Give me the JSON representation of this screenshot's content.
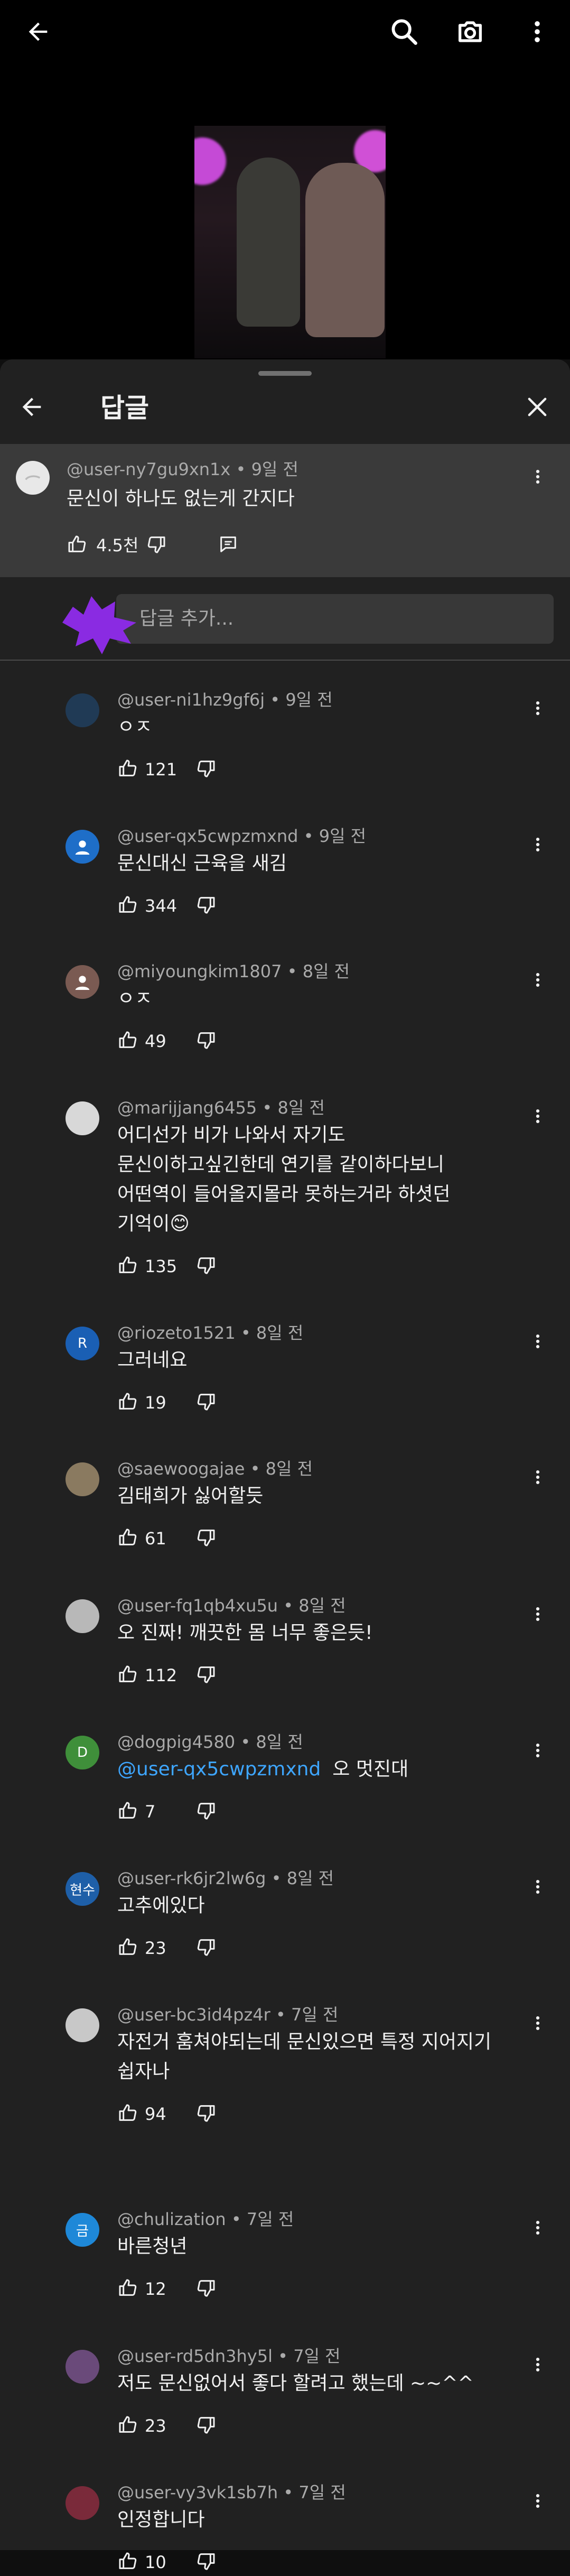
{
  "video": {
    "icons": [
      "back-arrow-icon",
      "search-icon",
      "camera-icon",
      "more-vert-icon"
    ]
  },
  "panel": {
    "title": "답글",
    "back_icon": "back-arrow-icon",
    "close_icon": "close-icon"
  },
  "parent_comment": {
    "author": "@user-ny7gu9xn1x",
    "time": "9일 전",
    "text": "문신이 하나도 없는게 간지다",
    "likes": "4.5천"
  },
  "add_reply": {
    "placeholder": "답글 추가..."
  },
  "replies": [
    {
      "author": "@user-ni1hz9gf6j",
      "time": "9일 전",
      "text": "ㅇㅈ",
      "likes": "121",
      "avatar": "img",
      "avatar_color": "#203a55"
    },
    {
      "author": "@user-qx5cwpzmxnd",
      "time": "9일 전",
      "text": "문신대신 근육을 새김",
      "likes": "344",
      "avatar": "person",
      "avatar_color": "#1e6ec8"
    },
    {
      "author": "@miyoungkim1807",
      "time": "8일 전",
      "text": "ㅇㅈ",
      "likes": "49",
      "avatar": "person",
      "avatar_color": "#7a5a52"
    },
    {
      "author": "@marijjang6455",
      "time": "8일 전",
      "text": "어디선가 비가 나와서 자기도\n문신이하고싶긴한데 연기를 같이하다보니\n어떤역이 들어올지몰라 못하는거라 하셧던\n기억이😊",
      "likes": "135",
      "avatar": "img",
      "avatar_color": "#d8d8d8"
    },
    {
      "author": "@riozeto1521",
      "time": "8일 전",
      "text": "그러네요",
      "likes": "19",
      "avatar": "R",
      "avatar_color": "#1a5fb4"
    },
    {
      "author": "@saewoogajae",
      "time": "8일 전",
      "text": "김태희가 싫어할듯",
      "likes": "61",
      "avatar": "img",
      "avatar_color": "#8a7a60"
    },
    {
      "author": "@user-fq1qb4xu5u",
      "time": "8일 전",
      "text": "오 진짜!  깨끗한 몸 너무 좋은듯!",
      "likes": "112",
      "avatar": "img",
      "avatar_color": "#b8b8b8"
    },
    {
      "author": "@dogpig4580",
      "time": "8일 전",
      "mention": "@user-qx5cwpzmxnd",
      "text": "오 멋진대",
      "likes": "7",
      "avatar": "D",
      "avatar_color": "#3f8f3a"
    },
    {
      "author": "@user-rk6jr2lw6g",
      "time": "8일 전",
      "text": "고추에있다",
      "likes": "23",
      "avatar": "현수",
      "avatar_color": "#1e5fa8"
    },
    {
      "author": "@user-bc3id4pz4r",
      "time": "7일 전",
      "text": "자전거 훔쳐야되는데 문신있으면 특정 지어지기\n쉽자나",
      "likes": "94",
      "avatar": "img",
      "avatar_color": "#c8c8c8"
    },
    {
      "author": "@chulization",
      "time": "7일 전",
      "text": "바른청년",
      "likes": "12",
      "avatar": "금",
      "avatar_color": "#1e88d8"
    },
    {
      "author": "@user-rd5dn3hy5l",
      "time": "7일 전",
      "text": "저도 문신없어서 좋다 할려고 했는데  ~~^^",
      "likes": "23",
      "avatar": "img",
      "avatar_color": "#6a4a7a"
    },
    {
      "author": "@user-vy3vk1sb7h",
      "time": "7일 전",
      "text": "인정합니다",
      "likes": "10",
      "avatar": "img",
      "avatar_color": "#7a2a3a"
    }
  ]
}
